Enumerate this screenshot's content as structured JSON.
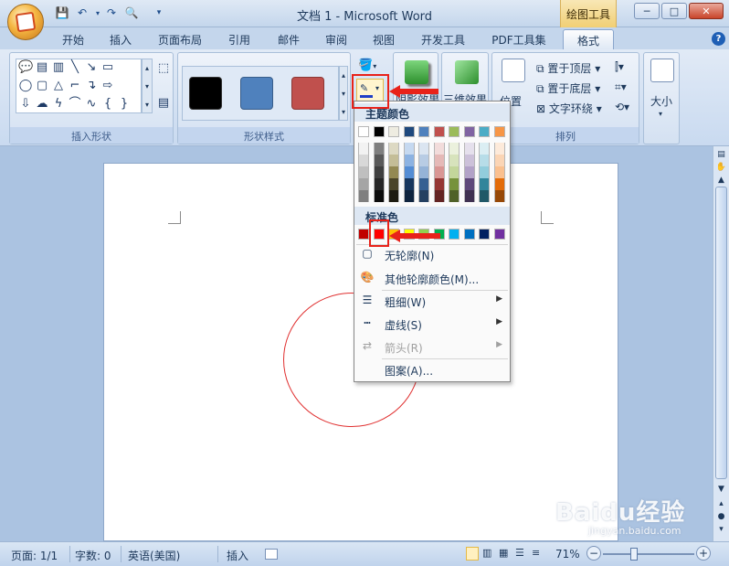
{
  "window": {
    "title": "文档 1 - Microsoft Word",
    "context_tab": "绘图工具",
    "min_label": "─",
    "max_label": "□",
    "close_label": "✕"
  },
  "tabs": [
    "开始",
    "插入",
    "页面布局",
    "引用",
    "邮件",
    "审阅",
    "视图",
    "开发工具",
    "PDF工具集",
    "格式"
  ],
  "active_tab": "格式",
  "ribbon": {
    "insert_shapes": {
      "label": "插入形状"
    },
    "shape_styles": {
      "label": "形状样式",
      "swatches": [
        "#000000",
        "#4f81bd",
        "#c0504d"
      ]
    },
    "shadow_effects": {
      "label": "阴影效果"
    },
    "threed_effects": {
      "label": "三维效果"
    },
    "arrange": {
      "label": "排列",
      "position": "位置",
      "bring_front": "置于顶层",
      "send_back": "置于底层",
      "text_wrap": "文字环绕"
    },
    "size": {
      "label": "大小"
    }
  },
  "menu": {
    "theme_colors_heading": "标准色",
    "theme_heading": "主题颜色",
    "standard_heading": "标准色",
    "theme_row": [
      "#ffffff",
      "#000000",
      "#eeece1",
      "#1f497d",
      "#4f81bd",
      "#c0504d",
      "#9bbb59",
      "#8064a2",
      "#4bacc6",
      "#f79646"
    ],
    "theme_shades": [
      [
        "#f2f2f2",
        "#7f7f7f",
        "#ddd9c3",
        "#c6d9f0",
        "#dbe5f1",
        "#f2dcdb",
        "#ebf1dd",
        "#e5e0ec",
        "#dbeef3",
        "#fdeada"
      ],
      [
        "#d8d8d8",
        "#595959",
        "#c4bd97",
        "#8db3e2",
        "#b8cce4",
        "#e5b9b7",
        "#d7e3bc",
        "#ccc1d9",
        "#b7dde8",
        "#fbd5b5"
      ],
      [
        "#bfbfbf",
        "#3f3f3f",
        "#938953",
        "#548dd4",
        "#95b3d7",
        "#d99694",
        "#c3d69b",
        "#b2a2c7",
        "#92cddc",
        "#fac08f"
      ],
      [
        "#a5a5a5",
        "#262626",
        "#494429",
        "#17365d",
        "#366092",
        "#953734",
        "#76923c",
        "#5f497a",
        "#31859b",
        "#e36c09"
      ],
      [
        "#7f7f7f",
        "#0c0c0c",
        "#1d1b10",
        "#0f243e",
        "#244061",
        "#632423",
        "#4f6128",
        "#3f3151",
        "#205867",
        "#974806"
      ]
    ],
    "standard_row": [
      "#c00000",
      "#ff0000",
      "#ffc000",
      "#ffff00",
      "#92d050",
      "#00b050",
      "#00b0f0",
      "#0070c0",
      "#002060",
      "#7030a0"
    ],
    "items": [
      {
        "label": "无轮廓(N)",
        "icon": "no-outline-icon",
        "disabled": false,
        "submenu": false
      },
      {
        "label": "其他轮廓颜色(M)...",
        "icon": "palette-icon",
        "disabled": false,
        "submenu": false
      },
      {
        "label": "粗细(W)",
        "icon": "line-weight-icon",
        "disabled": false,
        "submenu": true
      },
      {
        "label": "虚线(S)",
        "icon": "dashes-icon",
        "disabled": false,
        "submenu": true
      },
      {
        "label": "箭头(R)",
        "icon": "arrows-icon",
        "disabled": true,
        "submenu": true
      },
      {
        "label": "图案(A)...",
        "icon": "pattern-icon",
        "disabled": false,
        "submenu": false
      }
    ]
  },
  "status": {
    "page": "页面: 1/1",
    "words": "字数: 0",
    "language": "英语(美国)",
    "mode": "插入",
    "zoom": "71%"
  },
  "watermark": {
    "brand": "Baidu经验",
    "sub": "jingyan.baidu.com"
  }
}
